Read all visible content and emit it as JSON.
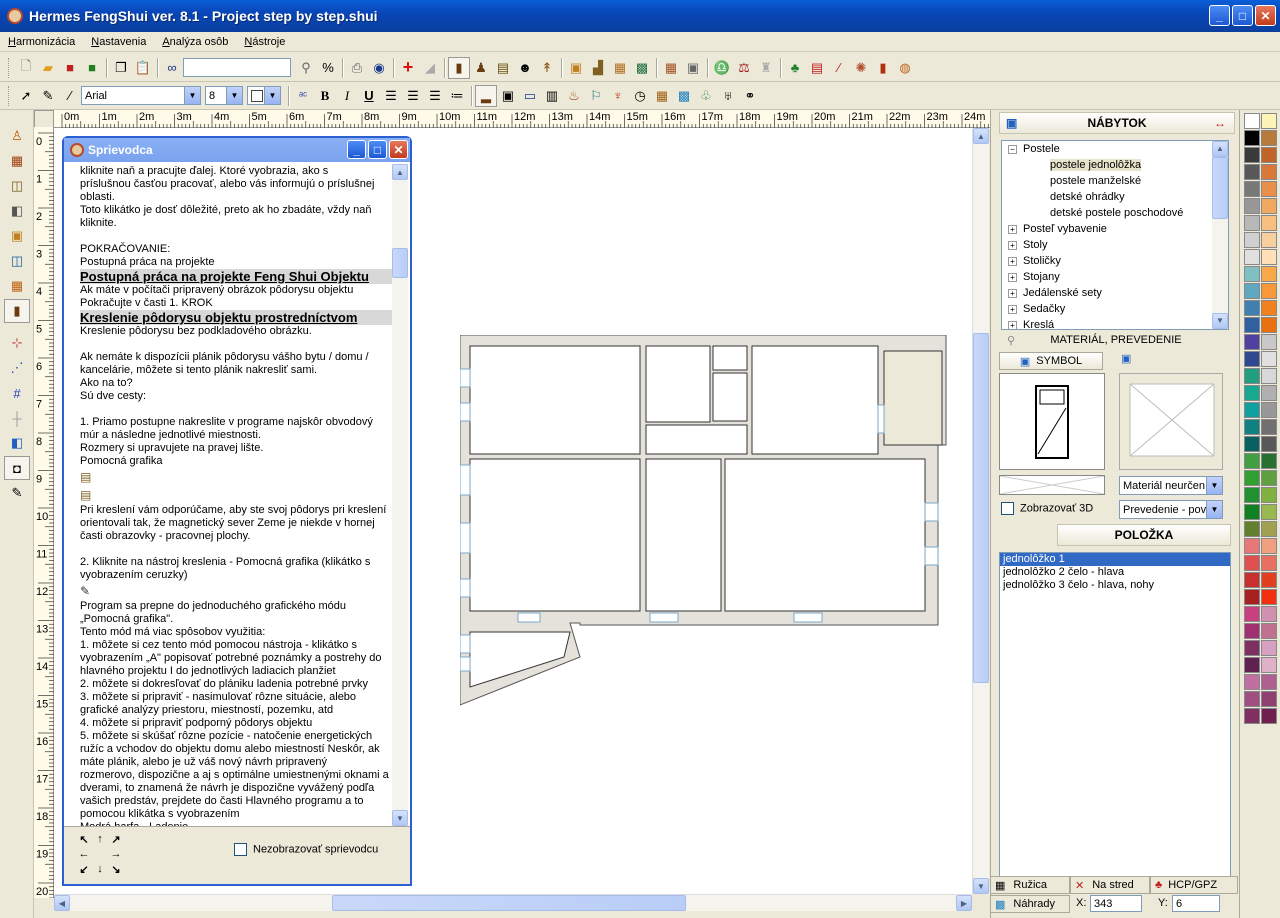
{
  "window": {
    "title": "Hermes FengShui ver. 8.1 - Project step by step.shui"
  },
  "menu": [
    "Harmonizácia",
    "Nastavenia",
    "Analýza osôb",
    "Nástroje"
  ],
  "toolbar2": {
    "font": "Arial",
    "size": "8"
  },
  "rulers": {
    "h": [
      "0m",
      "1m",
      "2m",
      "3m",
      "4m",
      "5m",
      "6m",
      "7m",
      "8m",
      "9m",
      "10m",
      "11m",
      "12m",
      "13m",
      "14m",
      "15m",
      "16m",
      "17m",
      "18m",
      "19m",
      "20m",
      "21m",
      "22m",
      "23m",
      "24m"
    ],
    "v": [
      "0",
      "1",
      "2",
      "3",
      "4",
      "5",
      "6",
      "7",
      "8",
      "9",
      "10",
      "11",
      "12",
      "13",
      "14",
      "15",
      "16",
      "17",
      "18",
      "19",
      "20"
    ]
  },
  "wizard": {
    "title": "Sprievodca",
    "lines": [
      {
        "t": "kliknite naň a pracujte ďalej. Ktoré vyobrazia, ako s"
      },
      {
        "t": "príslušnou časťou pracovať, alebo vás informujú o príslušnej"
      },
      {
        "t": "oblasti."
      },
      {
        "t": "Toto klikátko je dosť dôležité, preto ak ho zbadáte, vždy naň"
      },
      {
        "t": "kliknite."
      },
      {
        "t": ""
      },
      {
        "t": "POKRAČOVANIE:"
      },
      {
        "t": "Postupná práca na projekte"
      },
      {
        "t": "Postupná práca na projekte Feng Shui Objektu",
        "big": true
      },
      {
        "t": "Ak máte v počítači pripravený obrázok pôdorysu objektu"
      },
      {
        "t": "Pokračujte v časti 1. KROK"
      },
      {
        "t": "Kreslenie pôdorysu objektu prostredníctvom",
        "big": true
      },
      {
        "t": "Kreslenie pôdorysu bez podkladového obrázku."
      },
      {
        "t": ""
      },
      {
        "t": "Ak nemáte k dispozícii plánik pôdorysu vášho bytu / domu /"
      },
      {
        "t": "kancelárie, môžete si tento plánik nakresliť sami."
      },
      {
        "t": "Ako na to?"
      },
      {
        "t": "Sú dve cesty:"
      },
      {
        "t": ""
      },
      {
        "t": "1. Priamo postupne nakreslite v programe najskôr obvodový"
      },
      {
        "t": "múr a následne jednotlivé miestnosti."
      },
      {
        "t": "Rozmery si upravujete na pravej lište."
      },
      {
        "t": "Pomocná grafika"
      },
      {
        "icon": "walls-icon"
      },
      {
        "icon": "door-icon"
      },
      {
        "t": "Pri kreslení vám odporúčame, aby ste svoj pôdorys pri kreslení"
      },
      {
        "t": "orientovali tak, že magnetický sever Zeme je niekde v hornej"
      },
      {
        "t": "časti obrazovky - pracovnej plochy."
      },
      {
        "t": ""
      },
      {
        "t": "2. Kliknite na nástroj kreslenia - Pomocná grafika (klikátko s"
      },
      {
        "t": "vyobrazením ceruzky)"
      },
      {
        "icon": "pencil-icon"
      },
      {
        "t": "Program sa prepne do jednoduchého grafického módu"
      },
      {
        "t": "„Pomocná grafika\"."
      },
      {
        "t": "Tento mód má viac spôsobov využitia:"
      },
      {
        "t": "1. môžete si cez tento mód pomocou nástroja - klikátko s"
      },
      {
        "t": "vyobrazením „A\" popisovať potrebné poznámky a postrehy do"
      },
      {
        "t": "hlavného projektu I do jednotlivých ladiacich planžiet"
      },
      {
        "t": "2. môžete si dokresľovať do plániku ladenia potrebné prvky"
      },
      {
        "t": "3. môžete si pripraviť - nasimulovať rôzne situácie, alebo"
      },
      {
        "t": "grafické analýzy priestoru, miestností, pozemku, atd"
      },
      {
        "t": "4. môžete si pripraviť podporný pôdorys objektu"
      },
      {
        "t": "5. môžete si skúšať rôzne pozície - natočenie energetických"
      },
      {
        "t": "ružíc a vchodov do objektu domu alebo miestností Neskôr, ak"
      },
      {
        "t": "máte plánik, alebo je už váš nový návrh pripravený"
      },
      {
        "t": "rozmerovo, dispozične a aj s optimálne umiestnenými oknami a"
      },
      {
        "t": "dverami, to znamená že návrh je dispozične vyvážený podľa"
      },
      {
        "t": "vašich predstáv, prejdete do časti Hlavného programu a to"
      },
      {
        "t": "pomocou klikátka s vyobrazením"
      },
      {
        "t": "Modrá harfa - Ladenie"
      }
    ],
    "footer_checkbox": "Nezobrazovať sprievodcu"
  },
  "right_panel": {
    "header": "NÁBYTOK",
    "tree": [
      {
        "label": "Postele",
        "level": 0,
        "expanded": true
      },
      {
        "label": "postele jednolôžka",
        "level": 1,
        "selected": true
      },
      {
        "label": "postele manželské",
        "level": 1
      },
      {
        "label": "detské ohrádky",
        "level": 1
      },
      {
        "label": "detské postele poschodové",
        "level": 1
      },
      {
        "label": "Posteľ vybavenie",
        "level": 0
      },
      {
        "label": "Stoly",
        "level": 0
      },
      {
        "label": "Stoličky",
        "level": 0
      },
      {
        "label": "Stojany",
        "level": 0
      },
      {
        "label": "Jedálenské sety",
        "level": 0
      },
      {
        "label": "Sedačky",
        "level": 0
      },
      {
        "label": "Kreslá",
        "level": 0
      }
    ],
    "material_header": "MATERIÁL, PREVEDENIE",
    "symbol_tab": "SYMBOL",
    "show3d": "Zobrazovať 3D",
    "material_select": "Materiál neurčen",
    "prevedenie_select": "Prevedenie - pov",
    "polozka_header": "POLOŽKA",
    "items": [
      "jednolôžko 1",
      "jednolôžko 2 čelo - hlava",
      "jednolôžko 3 čelo - hlava, nohy"
    ]
  },
  "status": {
    "ruzica": "Ružica",
    "na_stred": "Na stred",
    "hcp": "HCP/GPZ",
    "nahrady": "Náhrady",
    "x_label": "X:",
    "x_value": "343",
    "y_label": "Y:",
    "y_value": "6"
  },
  "palette": [
    "#ffffff",
    "#fff4b8",
    "#000000",
    "#b87a3a",
    "#3a3a3a",
    "#c0642a",
    "#585858",
    "#d8783a",
    "#787878",
    "#e8904a",
    "#989898",
    "#f0a860",
    "#b8b8b8",
    "#f8c080",
    "#d0d0d0",
    "#f8d0a0",
    "#e0e0e0",
    "#ffe0b8",
    "#80c0c0",
    "#f8a848",
    "#60a8c0",
    "#f89838",
    "#4080b0",
    "#f08020",
    "#3060a0",
    "#e87010",
    "#5040a0",
    "#c8c8c8",
    "#304890",
    "#e0e0e0",
    "#20a080",
    "#d8d8d8",
    "#18a890",
    "#b0b0b0",
    "#10a0a0",
    "#989898",
    "#108080",
    "#707070",
    "#086060",
    "#585858",
    "#40a040",
    "#287030",
    "#30a030",
    "#60a040",
    "#209030",
    "#80b040",
    "#108020",
    "#98b850",
    "#608030",
    "#a0a050",
    "#e87878",
    "#f0a080",
    "#e05050",
    "#e87060",
    "#c83030",
    "#e04020",
    "#a82020",
    "#f03010",
    "#c84080",
    "#d090b0",
    "#a03070",
    "#c07090",
    "#803060",
    "#d8a0c0",
    "#602050",
    "#e0b0c8",
    "#c070a0",
    "#b06090",
    "#a05080",
    "#904070",
    "#803060",
    "#702050"
  ]
}
